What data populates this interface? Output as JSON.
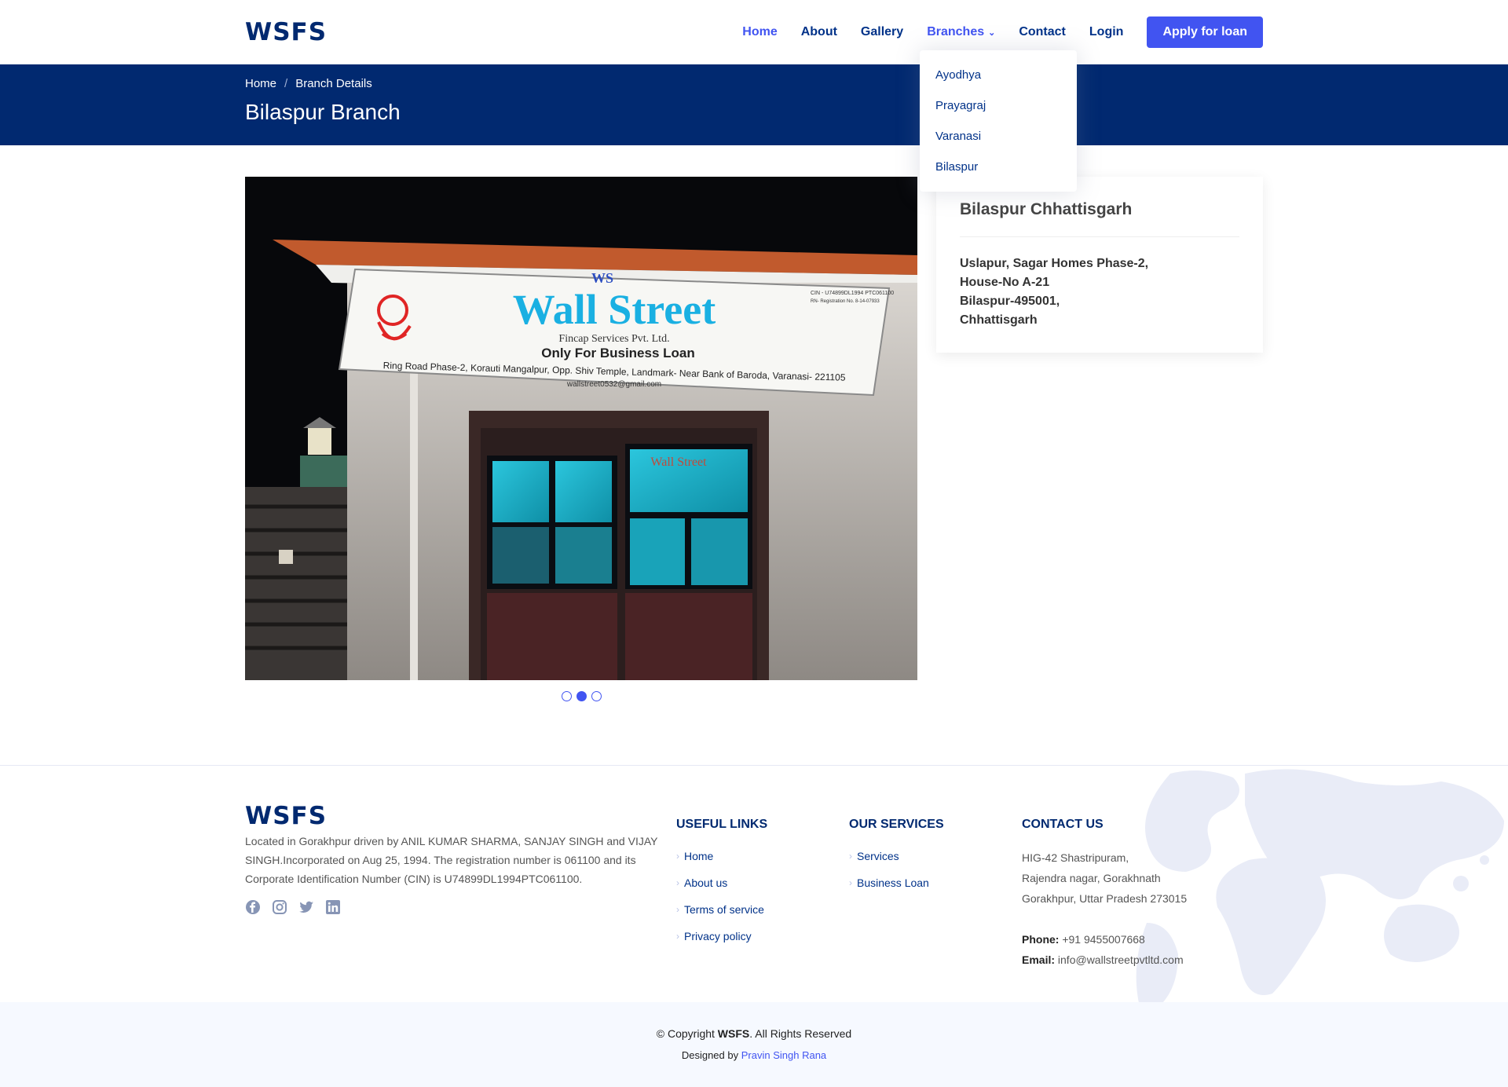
{
  "header": {
    "logo": "WSFS",
    "nav": {
      "home": "Home",
      "about": "About",
      "gallery": "Gallery",
      "branches": "Branches",
      "contact": "Contact",
      "login": "Login",
      "apply": "Apply for loan"
    },
    "dropdown": [
      "Ayodhya",
      "Prayagraj",
      "Varanasi",
      "Bilaspur"
    ]
  },
  "breadcrumb": {
    "home": "Home",
    "sep": "/",
    "current": "Branch Details",
    "title": "Bilaspur Branch"
  },
  "branch_photo": {
    "sign_logo": "WS",
    "sign_title": "Wall Street",
    "sign_sub": "Fincap Services Pvt. Ltd.",
    "sign_tagline": "Only For Business Loan",
    "sign_address": "Ring Road Phase-2, Korauti Mangalpur, Opp. Shiv Temple, Landmark- Near Bank of Baroda, Varanasi- 221105",
    "sign_email": "wallstreet0532@gmail.com",
    "sign_cin": "CIN - U74899DL1994 PTC061100",
    "sign_reg": "RN- Registration No. 8-14-07933",
    "glass_text": "Wall Street",
    "slides": 3,
    "active_slide": 2
  },
  "info_card": {
    "title": "Bilaspur Chhattisgarh",
    "address": [
      "Uslapur, Sagar Homes Phase-2,",
      "House-No A-21",
      "Bilaspur-495001,",
      "Chhattisgarh"
    ]
  },
  "footer": {
    "logo": "WSFS",
    "about": "Located in Gorakhpur driven by ANIL KUMAR SHARMA, SANJAY SINGH and VIJAY SINGH.Incorporated on Aug 25, 1994. The registration number is 061100 and its Corporate Identification Number (CIN) is U74899DL1994PTC061100.",
    "useful_links_title": "USEFUL LINKS",
    "useful_links": [
      "Home",
      "About us",
      "Terms of service",
      "Privacy policy"
    ],
    "services_title": "OUR SERVICES",
    "services": [
      "Services",
      "Business Loan"
    ],
    "contact_title": "CONTACT US",
    "contact_address": [
      "HIG-42 Shastripuram,",
      "Rajendra nagar, Gorakhnath",
      "Gorakhpur, Uttar Pradesh 273015"
    ],
    "phone_label": "Phone:",
    "phone": "+91 9455007668",
    "email_label": "Email:",
    "email": "info@wallstreetpvtltd.com",
    "copyright_prefix": "© Copyright",
    "copyright_brand": "WSFS",
    "copyright_suffix": ". All Rights Reserved",
    "designed_by": "Designed by",
    "designer": "Pravin Singh Rana"
  },
  "colors": {
    "primary": "#4154f1",
    "navy": "#012970",
    "link": "#013289"
  }
}
